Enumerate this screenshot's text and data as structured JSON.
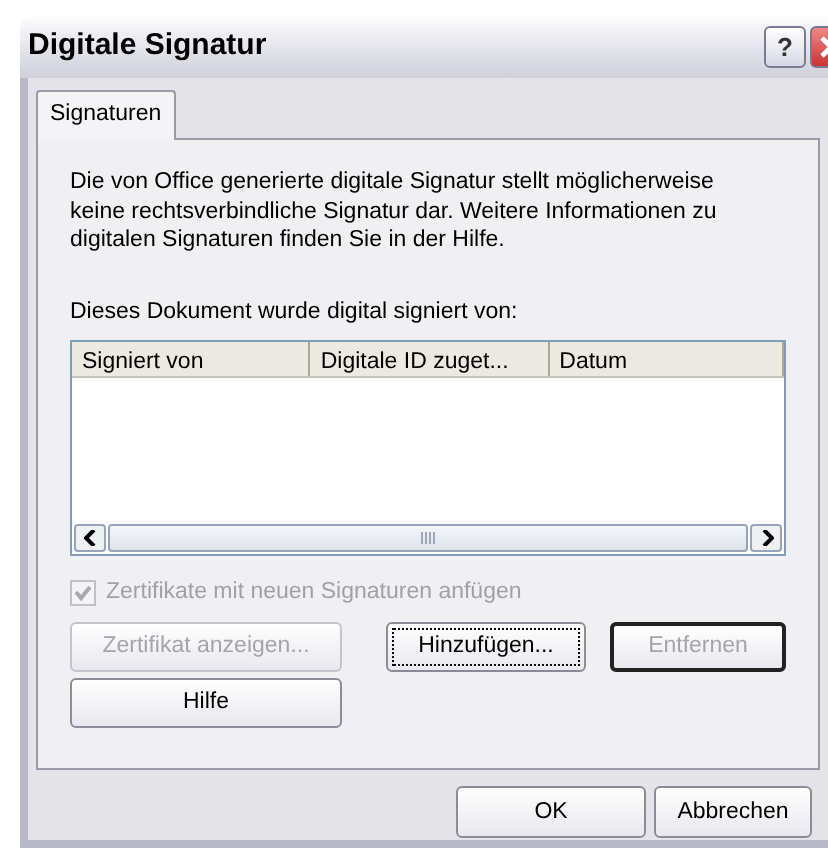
{
  "window": {
    "title": "Digitale Signatur",
    "help_button": "?"
  },
  "tabs": [
    {
      "label": "Signaturen",
      "selected": true
    }
  ],
  "info_text": "Die von Office generierte digitale Signatur stellt möglicherweise keine rechtsverbindliche Signatur dar. Weitere Informationen zu digitalen Signaturen finden Sie in der Hilfe.",
  "list_label": "Dieses Dokument wurde digital signiert von:",
  "table": {
    "columns": [
      "Signiert von",
      "Digitale ID zuget...",
      "Datum"
    ]
  },
  "checkbox": {
    "label": "Zertifikate mit neuen Signaturen anfügen",
    "checked": true,
    "disabled": true
  },
  "panel_buttons": [
    {
      "label": "Zertifikat anzeigen...",
      "disabled": true,
      "focused": false,
      "default": false
    },
    {
      "label": "Hinzufügen...",
      "disabled": false,
      "focused": true,
      "default": false
    },
    {
      "label": "Entfernen",
      "disabled": true,
      "focused": false,
      "default": true
    },
    {
      "label": "Hilfe",
      "disabled": false,
      "focused": false,
      "default": false
    }
  ],
  "dialog_buttons": [
    {
      "label": "OK",
      "disabled": false
    },
    {
      "label": "Abbrechen",
      "disabled": false
    }
  ]
}
